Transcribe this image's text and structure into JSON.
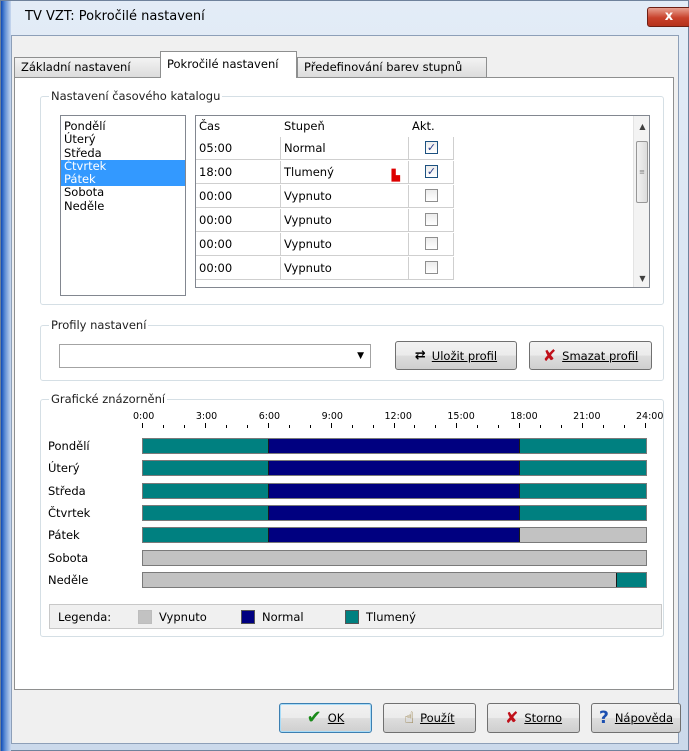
{
  "window": {
    "title": "TV VZT: Pokročilé nastavení",
    "close_label": "x"
  },
  "tabs": [
    {
      "label": "Základní nastavení"
    },
    {
      "label": "Pokročilé nastavení"
    },
    {
      "label": "Předefinování barev stupnů"
    }
  ],
  "schedule": {
    "group_label": "Nastavení časového katalogu",
    "days": [
      "Pondělí",
      "Úterý",
      "Středa",
      "Čtvrtek",
      "Pátek",
      "Sobota",
      "Neděle"
    ],
    "selected_days": [
      "Čtvrtek",
      "Pátek"
    ],
    "columns": [
      "Čas",
      "Stupeň",
      "Akt."
    ],
    "rows": [
      {
        "time": "05:00",
        "level": "Normal",
        "active": true
      },
      {
        "time": "18:00",
        "level": "Tlumený",
        "active": true
      },
      {
        "time": "00:00",
        "level": "Vypnuto",
        "active": false
      },
      {
        "time": "00:00",
        "level": "Vypnuto",
        "active": false
      },
      {
        "time": "00:00",
        "level": "Vypnuto",
        "active": false
      },
      {
        "time": "00:00",
        "level": "Vypnuto",
        "active": false
      }
    ]
  },
  "profiles": {
    "group_label": "Profily nastavení",
    "selected": "",
    "save_label": "Uložit profil",
    "delete_label": "Smazat profil"
  },
  "graph": {
    "group_label": "Grafické znázornění",
    "ticks": [
      "0:00",
      "3:00",
      "6:00",
      "9:00",
      "12:00",
      "15:00",
      "18:00",
      "21:00",
      "24:00"
    ],
    "days": [
      {
        "label": "Pondělí",
        "segments": [
          {
            "from": 0,
            "to": 6,
            "level": "Tlumený"
          },
          {
            "from": 6,
            "to": 18,
            "level": "Normal"
          },
          {
            "from": 18,
            "to": 24,
            "level": "Tlumený"
          }
        ]
      },
      {
        "label": "Úterý",
        "segments": [
          {
            "from": 0,
            "to": 6,
            "level": "Tlumený"
          },
          {
            "from": 6,
            "to": 18,
            "level": "Normal"
          },
          {
            "from": 18,
            "to": 24,
            "level": "Tlumený"
          }
        ]
      },
      {
        "label": "Středa",
        "segments": [
          {
            "from": 0,
            "to": 6,
            "level": "Tlumený"
          },
          {
            "from": 6,
            "to": 18,
            "level": "Normal"
          },
          {
            "from": 18,
            "to": 24,
            "level": "Tlumený"
          }
        ]
      },
      {
        "label": "Čtvrtek",
        "segments": [
          {
            "from": 0,
            "to": 6,
            "level": "Tlumený"
          },
          {
            "from": 6,
            "to": 18,
            "level": "Normal"
          },
          {
            "from": 18,
            "to": 24,
            "level": "Tlumený"
          }
        ]
      },
      {
        "label": "Pátek",
        "segments": [
          {
            "from": 0,
            "to": 6,
            "level": "Tlumený"
          },
          {
            "from": 6,
            "to": 18,
            "level": "Normal"
          },
          {
            "from": 18,
            "to": 24,
            "level": "Vypnuto"
          }
        ]
      },
      {
        "label": "Sobota",
        "segments": [
          {
            "from": 0,
            "to": 24,
            "level": "Vypnuto"
          }
        ]
      },
      {
        "label": "Neděle",
        "segments": [
          {
            "from": 0,
            "to": 22.6,
            "level": "Vypnuto"
          },
          {
            "from": 22.6,
            "to": 24,
            "level": "Tlumený"
          }
        ]
      }
    ],
    "legend_label": "Legenda:",
    "legend": [
      {
        "name": "Vypnuto",
        "color": "#c2c2c2"
      },
      {
        "name": "Normal",
        "color": "#000080"
      },
      {
        "name": "Tlumený",
        "color": "#008080"
      }
    ]
  },
  "buttons": {
    "ok": "OK",
    "apply": "Použít",
    "cancel": "Storno",
    "help": "Nápověda"
  }
}
